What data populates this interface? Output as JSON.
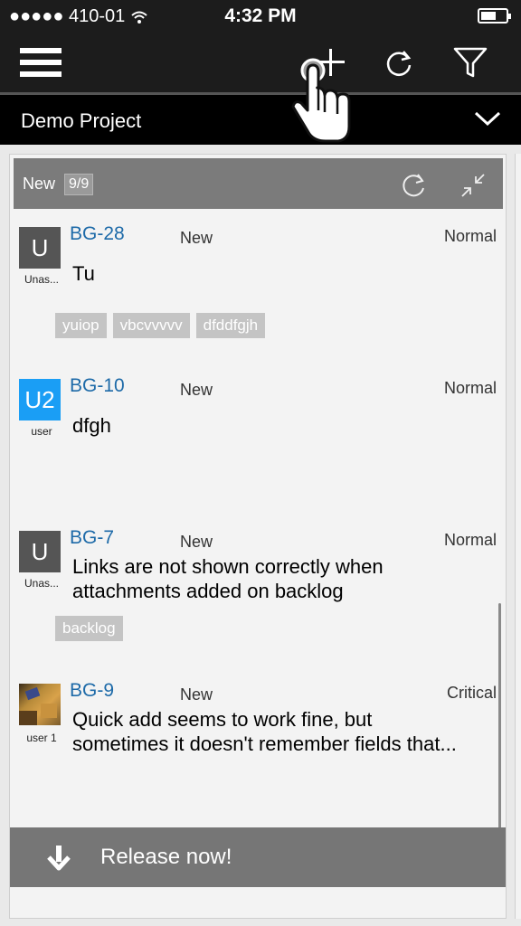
{
  "status_bar": {
    "carrier": "●●●●● 410-01",
    "time": "4:32 PM",
    "battery_level": 0.6
  },
  "toolbar": {
    "icons": [
      "menu-icon",
      "plus-icon",
      "refresh-icon",
      "filter-icon"
    ]
  },
  "project": {
    "name": "Demo Project"
  },
  "column": {
    "title": "New",
    "count": "9/9"
  },
  "cards": [
    {
      "id": "BG-28",
      "status": "New",
      "priority": "Normal",
      "title": "Tu",
      "avatar_text": "U",
      "assignee": "Unas...",
      "tags": [
        "yuiop",
        "vbcvvvvv",
        "dfddfgjh"
      ]
    },
    {
      "id": "BG-10",
      "status": "New",
      "priority": "Normal",
      "title": "dfgh",
      "avatar_text": "U2",
      "assignee": "user",
      "tags": []
    },
    {
      "id": "BG-7",
      "status": "New",
      "priority": "Normal",
      "title_line1": "Links are not shown correctly when",
      "title_line2": "attachments added on backlog",
      "avatar_text": "U",
      "assignee": "Unas...",
      "tags": [
        "backlog"
      ]
    },
    {
      "id": "BG-9",
      "status": "New",
      "priority": "Critical",
      "title_line1": "Quick add seems to work fine, but",
      "title_line2": "sometimes it doesn't remember fields that...",
      "assignee": "user 1",
      "tags": []
    }
  ],
  "release": {
    "label": "Release now!"
  },
  "colors": {
    "bar_background": "#1c1c1c",
    "link_blue": "#1d6aa8",
    "avatar_blue": "#1a9ef5",
    "column_header": "#7b7b7b"
  }
}
